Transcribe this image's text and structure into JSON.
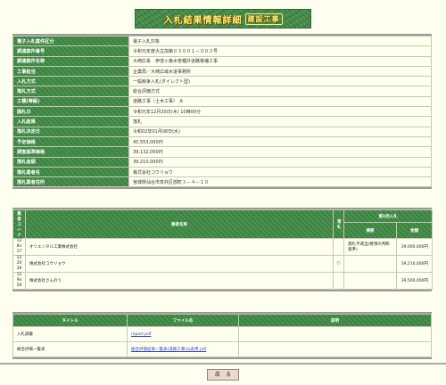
{
  "page": {
    "title": "入札結果情報詳細",
    "title_tag": "建設工事"
  },
  "info": [
    {
      "label": "電子入札案件区分",
      "value": "電子入札対象"
    },
    {
      "label": "調達案件番号",
      "value": "令和元年度大古加第０３００１－００３号"
    },
    {
      "label": "調達案件名称",
      "value": "大崎広系　伊達ヶ森水管種外道路移補工事"
    },
    {
      "label": "工事担当",
      "value": "企業局／大崎広域水道事務所"
    },
    {
      "label": "入札方式",
      "value": "一般競争入札(ダイレクト型)"
    },
    {
      "label": "落札方式",
      "value": "総合評価方式"
    },
    {
      "label": "工種(等級)",
      "value": "道路工事（土木工事）　A"
    },
    {
      "label": "開札日",
      "value": "令和元年12月20日(木) 10時00分"
    },
    {
      "label": "入札結果",
      "value": "落札"
    },
    {
      "label": "落札決定日",
      "value": "令和02年01月08日(水)"
    },
    {
      "label": "予定価格",
      "value": "45,553,000円"
    },
    {
      "label": "調査基準価格",
      "value": "39,132,000円"
    },
    {
      "label": "落札金額",
      "value": "39,210,000円"
    },
    {
      "label": "落札業者名",
      "value": "株式会社コウリョウ"
    },
    {
      "label": "落札業者住所",
      "value": "宮城県仙台市泉外区部町３－４－１０"
    }
  ],
  "bidders": {
    "headers": {
      "no": "業者コード",
      "name": "業者名称",
      "result": "落札",
      "amount_group": "第1回入札",
      "summary": "摘要",
      "amount": "金額"
    },
    "rows": [
      {
        "code": "12 8v 17",
        "name": "オリエンタル工業株式会社",
        "mark": "",
        "summary": "落札不適当(要領の判断基準)",
        "amount": "39,000,000円"
      },
      {
        "code": "12 20 39",
        "name": "株式会社コウリョウ",
        "mark": "○",
        "summary": "",
        "amount": "39,210,000円"
      },
      {
        "code": "12 9o 56",
        "name": "株式会社さんのう",
        "mark": "",
        "summary": "",
        "amount": "39,500,000円"
      }
    ]
  },
  "docs": {
    "headers": {
      "title": "タイトル",
      "file": "ファイル名",
      "note": "説明"
    },
    "rows": [
      {
        "title": "入札調書",
        "file": "report.pdf",
        "note": ""
      },
      {
        "title": "総合評価一覧表",
        "file": "総合評価結果一覧表(道路工事)公表用.pdf",
        "note": ""
      }
    ]
  },
  "back_label": "戻　る"
}
